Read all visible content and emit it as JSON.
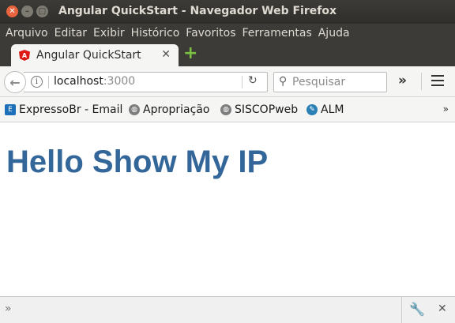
{
  "window": {
    "title": "Angular QuickStart - Navegador Web Firefox"
  },
  "menu": [
    "Arquivo",
    "Editar",
    "Exibir",
    "Histórico",
    "Favoritos",
    "Ferramentas",
    "Ajuda"
  ],
  "tab": {
    "title": "Angular QuickStart",
    "favicon_letter": "A"
  },
  "address": {
    "host": "localhost",
    "port": ":3000"
  },
  "search": {
    "placeholder": "Pesquisar"
  },
  "bookmarks": [
    {
      "label": "ExpressoBr - Email",
      "icon": "expresso-icon"
    },
    {
      "label": "Apropriação",
      "icon": "globe-icon"
    },
    {
      "label": "SISCOPweb",
      "icon": "globe-icon"
    },
    {
      "label": "ALM",
      "icon": "alm-icon"
    }
  ],
  "page": {
    "heading": "Hello Show My IP",
    "heading_color": "#336699"
  },
  "colors": {
    "titlebar": "#3c3b37",
    "close_button": "#e7643f",
    "new_tab": "#7ac142"
  }
}
